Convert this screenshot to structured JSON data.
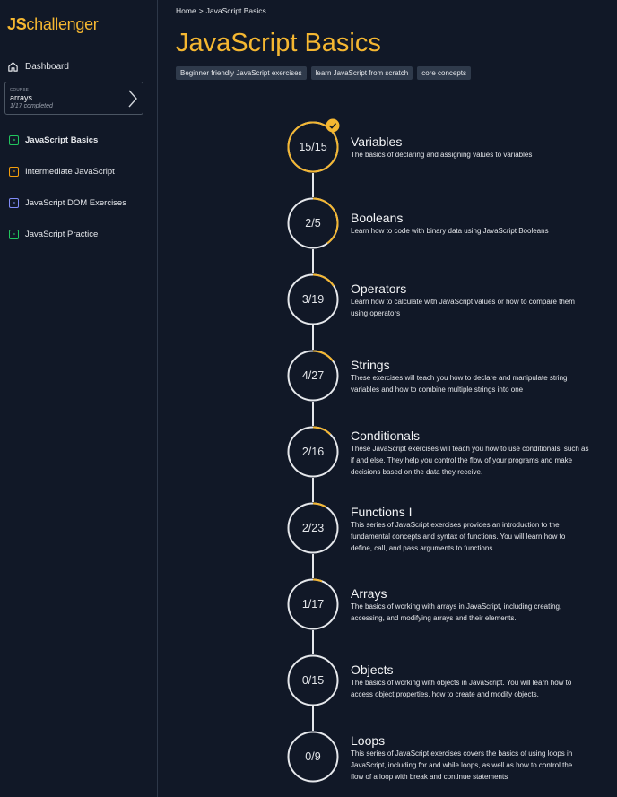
{
  "brand": {
    "logo_prefix": "JS",
    "logo_suffix": "challenger",
    "accent_color": "#f5b731"
  },
  "sidebar": {
    "dashboard_label": "Dashboard",
    "course": {
      "kicker": "COURSE",
      "name": "arrays",
      "progress": "1/17 completed"
    },
    "items": [
      {
        "label": "JavaScript Basics",
        "icon_color": "#22c55e",
        "active": true
      },
      {
        "label": "Intermediate JavaScript",
        "icon_color": "#f59e0b"
      },
      {
        "label": "JavaScript DOM Exercises",
        "icon_color": "#818cf8"
      },
      {
        "label": "JavaScript Practice",
        "icon_color": "#22c55e"
      }
    ]
  },
  "breadcrumb": {
    "home": "Home",
    "separator": ">",
    "current": "JavaScript Basics"
  },
  "page": {
    "title": "JavaScript Basics",
    "tags": [
      "Beginner friendly JavaScript exercises",
      "learn JavaScript from scratch",
      "core concepts"
    ]
  },
  "lessons": [
    {
      "title": "Variables",
      "count": "15/15",
      "done": 15,
      "total": 15,
      "completed": true,
      "description": [
        "The basics of declaring and assigning values to variables"
      ]
    },
    {
      "title": "Booleans",
      "count": "2/5",
      "done": 2,
      "total": 5,
      "description": [
        "Learn how to code with binary data using JavaScript Booleans"
      ]
    },
    {
      "title": "Operators",
      "count": "3/19",
      "done": 3,
      "total": 19,
      "description": [
        "Learn how to calculate with JavaScript values or how to compare them",
        "using operators"
      ]
    },
    {
      "title": "Strings",
      "count": "4/27",
      "done": 4,
      "total": 27,
      "description": [
        "These exercises will teach you how to declare and manipulate string",
        "variables and how to combine multiple strings into one"
      ]
    },
    {
      "title": "Conditionals",
      "count": "2/16",
      "done": 2,
      "total": 16,
      "description": [
        "These JavaScript exercises will teach you how to use conditionals, such as",
        "if and else. They help you control the flow of your programs and make",
        "decisions based on the data they receive."
      ]
    },
    {
      "title": "Functions I",
      "count": "2/23",
      "done": 2,
      "total": 23,
      "description": [
        "This series of JavaScript exercises provides an introduction to the",
        "fundamental concepts and syntax of functions. You will learn how to",
        "define, call, and pass arguments to functions"
      ]
    },
    {
      "title": "Arrays",
      "count": "1/17",
      "done": 1,
      "total": 17,
      "description": [
        "The basics of working with arrays in JavaScript, including creating,",
        "accessing, and modifying arrays and their elements."
      ]
    },
    {
      "title": "Objects",
      "count": "0/15",
      "done": 0,
      "total": 15,
      "description": [
        "The basics of working with objects in JavaScript. You will learn how to",
        "access object properties, how to create and modify objects."
      ]
    },
    {
      "title": "Loops",
      "count": "0/9",
      "done": 0,
      "total": 9,
      "description": [
        "This series of JavaScript exercises covers the basics of using loops in",
        "JavaScript, including for and while loops, as well as how to control the",
        "flow of a loop with break and continue statements"
      ]
    }
  ]
}
